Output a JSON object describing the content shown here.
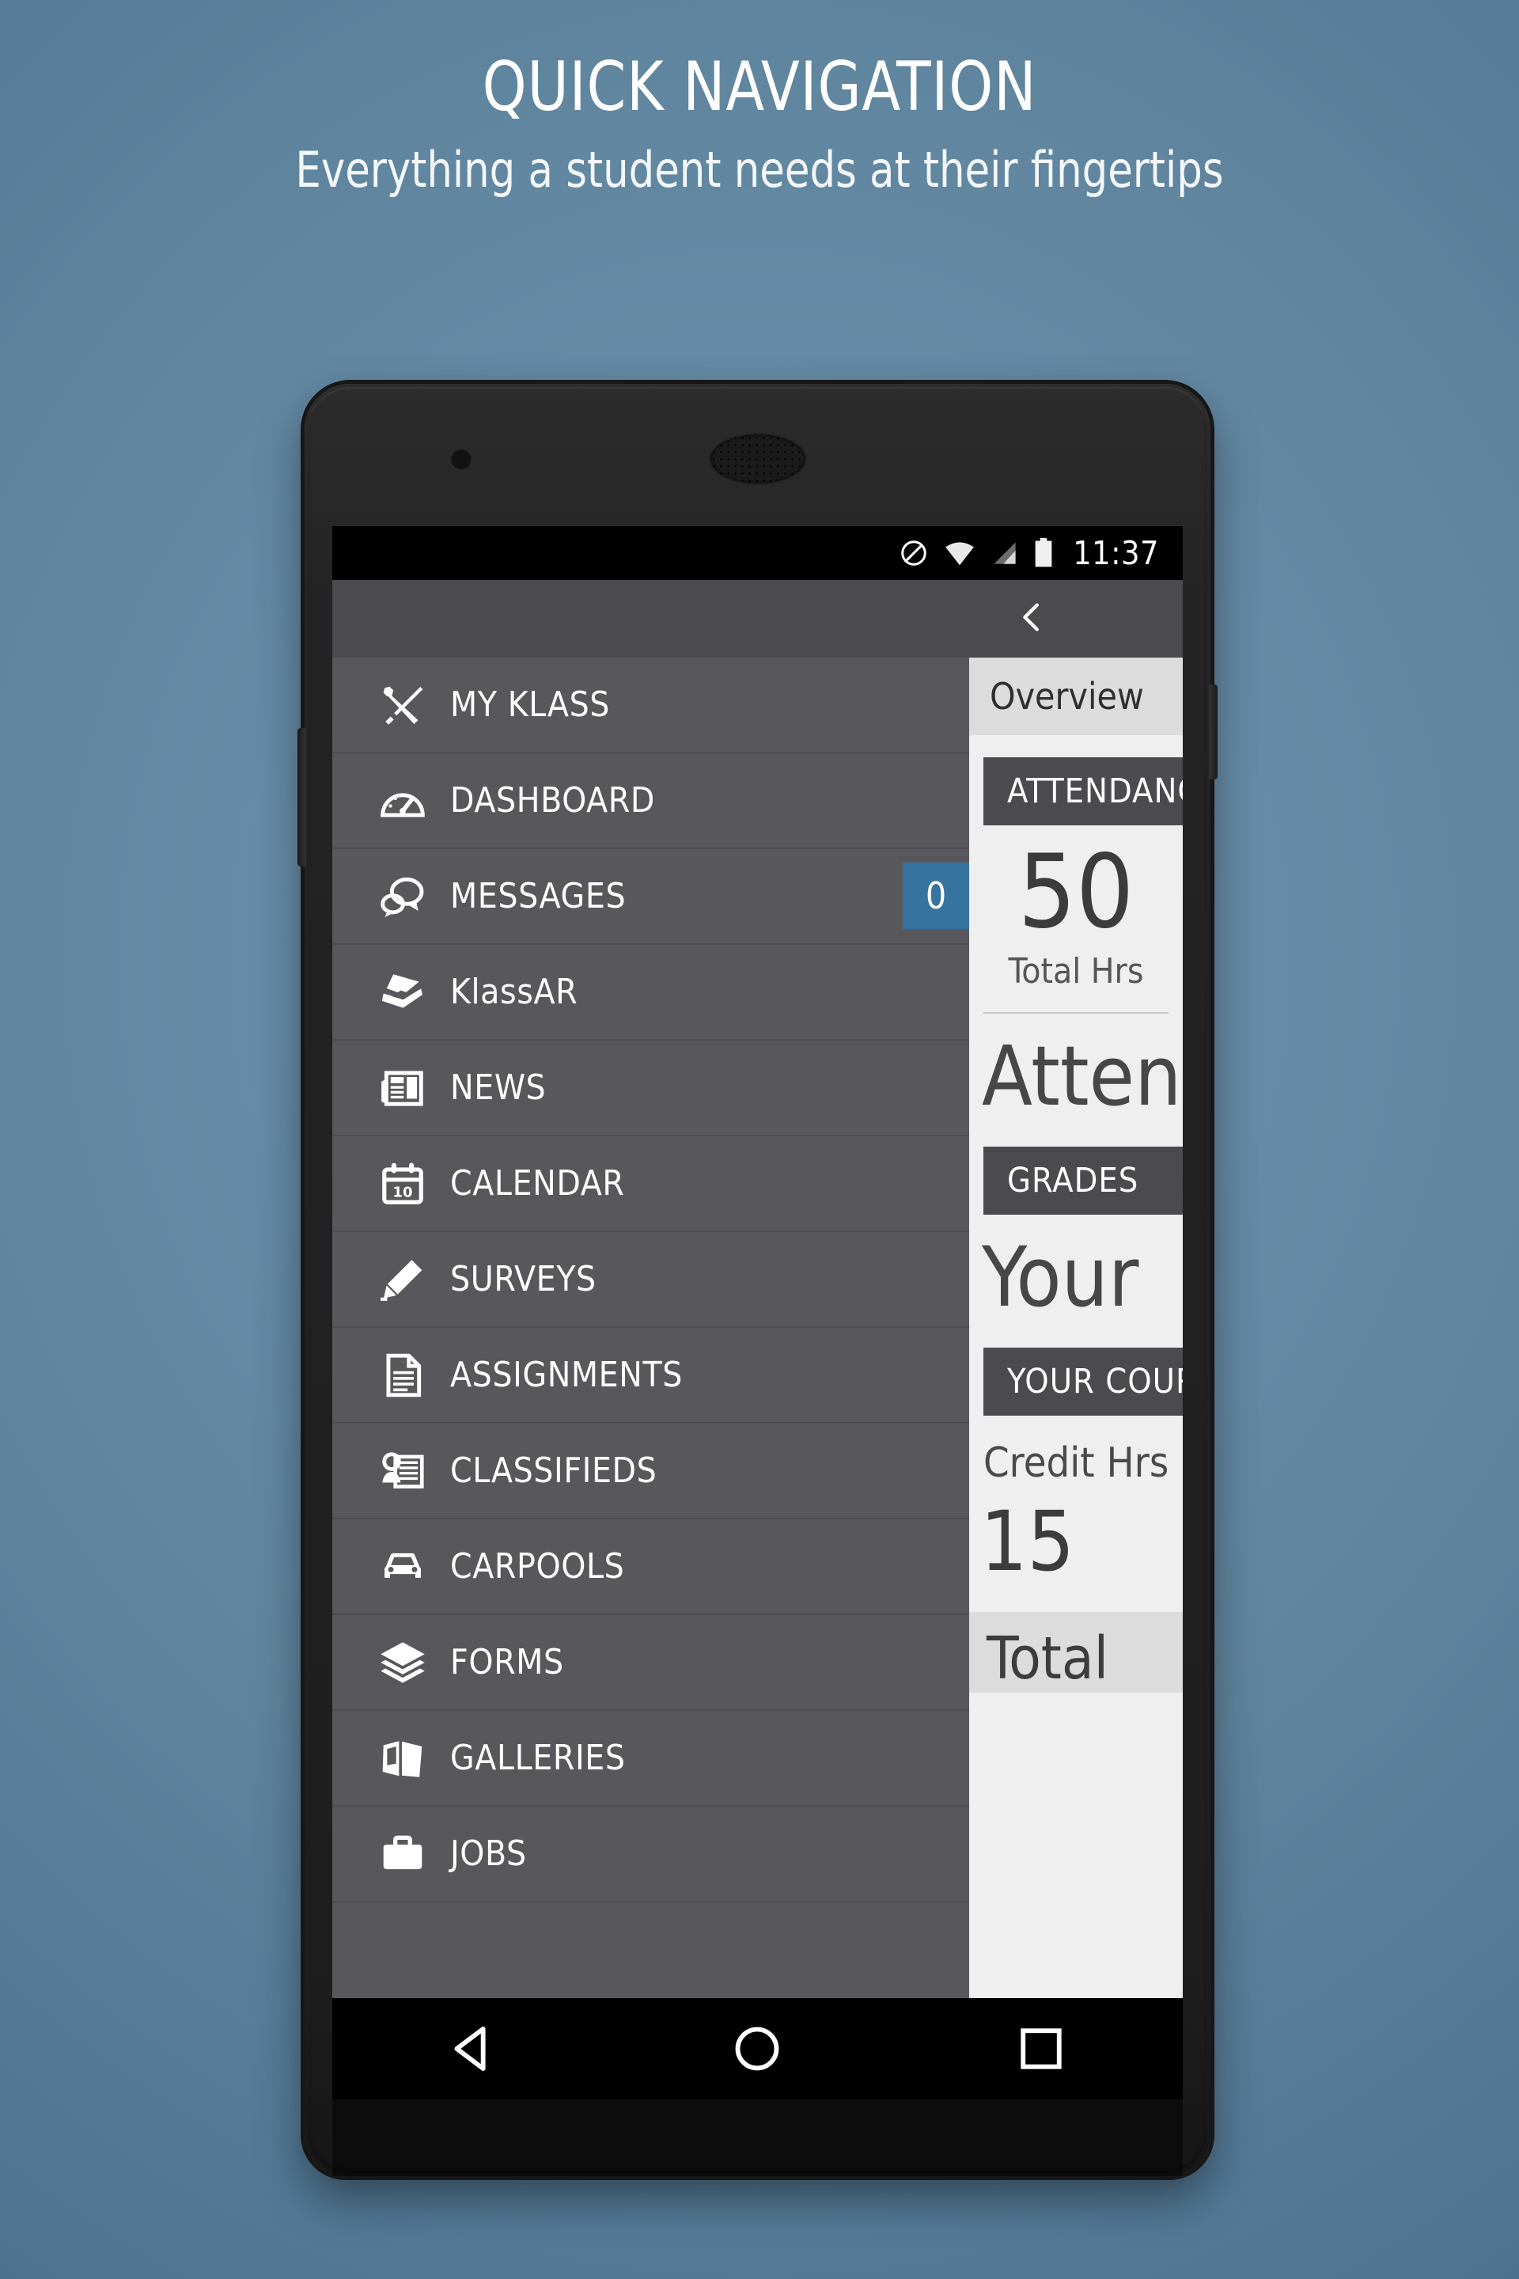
{
  "promo": {
    "title": "QUICK NAVIGATION",
    "subtitle": "Everything a student needs at their fingertips"
  },
  "status_bar": {
    "time": "11:37",
    "icons": [
      "do-not-disturb-icon",
      "wifi-icon",
      "cell-signal-icon",
      "battery-icon"
    ]
  },
  "toolbar": {
    "back_label": "<"
  },
  "drawer": {
    "items": [
      {
        "label": "MY KLASS",
        "icon": "tools-icon"
      },
      {
        "label": "DASHBOARD",
        "icon": "speedometer-icon"
      },
      {
        "label": "MESSAGES",
        "icon": "chat-bubbles-icon",
        "badge": "0"
      },
      {
        "label": "KlassAR",
        "icon": "scanner-icon"
      },
      {
        "label": "NEWS",
        "icon": "newspaper-icon"
      },
      {
        "label": "CALENDAR",
        "icon": "calendar-icon"
      },
      {
        "label": "SURVEYS",
        "icon": "pencil-icon"
      },
      {
        "label": "ASSIGNMENTS",
        "icon": "document-icon"
      },
      {
        "label": "CLASSIFIEDS",
        "icon": "classifieds-icon"
      },
      {
        "label": "CARPOOLS",
        "icon": "car-icon"
      },
      {
        "label": "FORMS",
        "icon": "layers-icon"
      },
      {
        "label": "GALLERIES",
        "icon": "gallery-icon"
      },
      {
        "label": "JOBS",
        "icon": "briefcase-icon"
      }
    ]
  },
  "content": {
    "tab_label": "Overview",
    "attendance_header": "ATTENDANCE",
    "attendance_value": "50",
    "attendance_caption": "Total Hrs",
    "attendance_title": "Attendance",
    "grades_header": "GRADES",
    "grades_value": "Your",
    "courses_header": "YOUR COURSES",
    "credit_label": "Credit Hrs",
    "credit_value": "15",
    "footer_label": "Total"
  },
  "nav_bar": {
    "back": "back-triangle-icon",
    "home": "home-circle-icon",
    "recents": "recents-square-icon"
  },
  "colors": {
    "badge_blue": "#36749f",
    "drawer_bg": "#58585c",
    "toolbar_bg": "#4a4a4f",
    "content_bg": "#efefef"
  }
}
